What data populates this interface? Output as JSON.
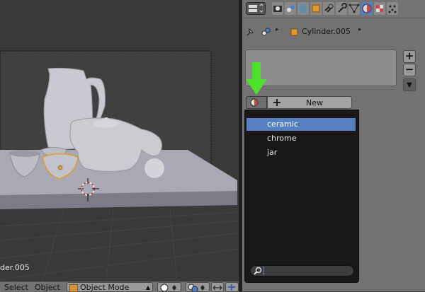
{
  "viewport": {
    "object_name_fragment": "der.005"
  },
  "bottom_bar": {
    "menu_select": "Select",
    "menu_object": "Object",
    "mode_value": "Object Mode"
  },
  "properties": {
    "breadcrumb_object": "Cylinder.005",
    "new_button_label": "New",
    "add_slot_symbol": "+",
    "remove_slot_symbol": "−",
    "more_symbol": "▼"
  },
  "material_dropdown": {
    "items": [
      {
        "label": "ceramic",
        "selected": true
      },
      {
        "label": "chrome",
        "selected": false
      },
      {
        "label": "jar",
        "selected": false
      }
    ],
    "search_value": ""
  },
  "colors": {
    "selection_blue": "#5680c2",
    "arrow_green": "#4ee12a",
    "active_tab_blue": "#5680c2"
  }
}
